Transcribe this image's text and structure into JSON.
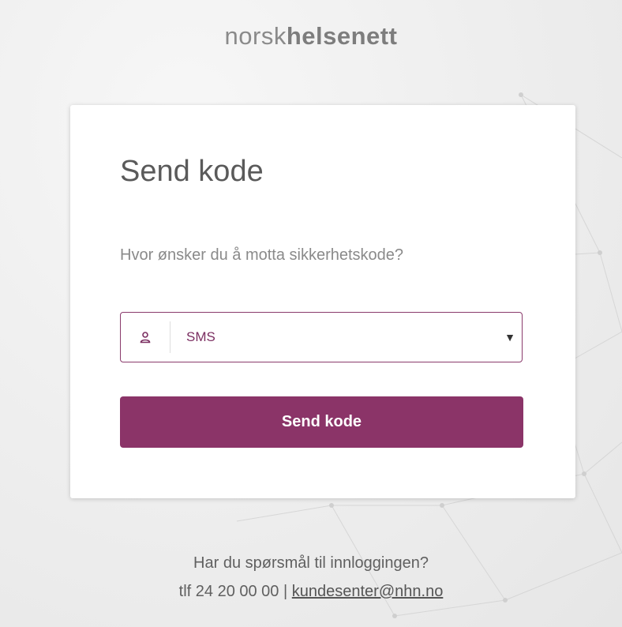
{
  "logo": {
    "part1": "norsk",
    "part2": "helsenett"
  },
  "card": {
    "title": "Send kode",
    "question": "Hvor ønsker du å motta sikkerhetskode?",
    "select": {
      "value": "SMS",
      "icon": "user-icon"
    },
    "button_label": "Send kode"
  },
  "footer": {
    "question": "Har du spørsmål til innloggingen?",
    "phone": "tlf 24 20 00 00",
    "separator": "|",
    "email": "kundesenter@nhn.no"
  },
  "colors": {
    "accent": "#8b3468",
    "accent_text": "#7b2e61",
    "background": "#efefef"
  }
}
